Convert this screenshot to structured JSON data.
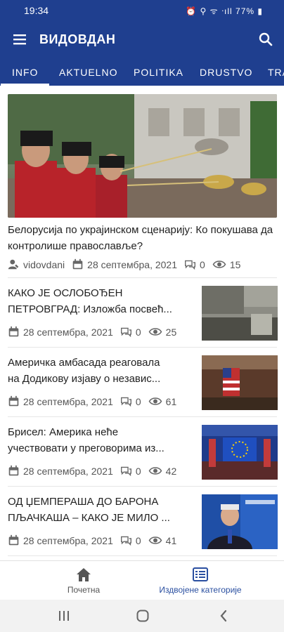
{
  "status_bar": {
    "time": "19:34",
    "indicators": "⏰ ⚲ ᯤ ᐧıll 77% ▮",
    "battery": "77%"
  },
  "app_bar": {
    "title": "ВИДОВДАН",
    "menu_icon": "menu-icon",
    "search_icon": "search-icon"
  },
  "tabs": [
    {
      "label": "INFO",
      "active": true
    },
    {
      "label": "AKTUELNO",
      "active": false
    },
    {
      "label": "POLITIKA",
      "active": false
    },
    {
      "label": "DRUSTVO",
      "active": false
    },
    {
      "label": "TRA",
      "active": false
    }
  ],
  "hero": {
    "title": "Белорусија по украјинском сценарију: Ко покушава да контролише православље?",
    "author": "vidovdani",
    "date": "28 септембра, 2021",
    "comments": "0",
    "views": "15"
  },
  "articles": [
    {
      "title_line1": "КАКО ЈЕ ОСЛОБОЂЕН",
      "title_line2": "ПЕТРОВГРАД: Изложба посвећ...",
      "date": "28 септембра, 2021",
      "comments": "0",
      "views": "25"
    },
    {
      "title_line1": "Америчка амбасада реаговала",
      "title_line2": "на Додикову изјаву о независ...",
      "date": "28 септембра, 2021",
      "comments": "0",
      "views": "61"
    },
    {
      "title_line1": "Брисел: Америка неће",
      "title_line2": "учествовати у преговорима из...",
      "date": "28 септембра, 2021",
      "comments": "0",
      "views": "42"
    },
    {
      "title_line1": "ОД ЏЕМПЕРАША ДО БАРОНА",
      "title_line2": "ПЉАЧКАША – КАКО ЈЕ МИЛО ...",
      "date": "28 септембра, 2021",
      "comments": "0",
      "views": "41"
    }
  ],
  "bottom_nav": {
    "home_label": "Почетна",
    "categories_label": "Издвојене категорије"
  },
  "colors": {
    "primary": "#1f3f8f",
    "accent_active": "#2a4fa0",
    "muted": "#555555"
  }
}
